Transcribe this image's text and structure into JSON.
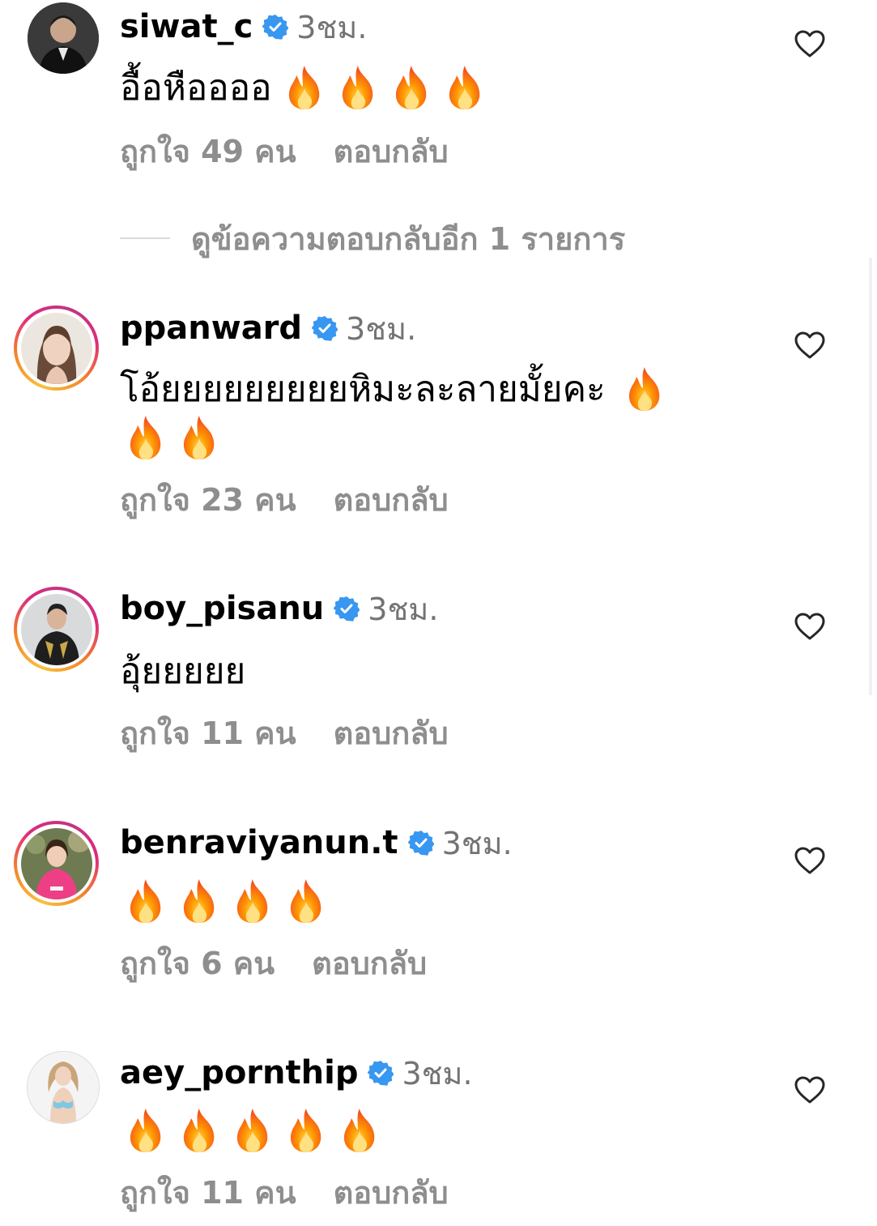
{
  "colors": {
    "text_primary": "#000000",
    "text_secondary": "#8e8e8e",
    "verified_blue": "#3897f0",
    "fire": "#f4511e"
  },
  "icons": {
    "verified": "verified-badge-icon",
    "like": "heart-outline-icon",
    "emoji": "fire-emoji"
  },
  "comments": [
    {
      "username": "siwat_c",
      "time": "3ชม.",
      "text": "อื้อหืออออ",
      "fire_count": 4,
      "likes": "ถูกใจ 49 คน",
      "reply_label": "ตอบกลับ",
      "story_ring": false
    },
    {
      "username": "ppanward",
      "time": "3ชม.",
      "text": "โอ้ยยยยยยยยยหิมะละลายมั้ยคะ",
      "fire_count": 3,
      "likes": "ถูกใจ 23 คน",
      "reply_label": "ตอบกลับ",
      "story_ring": true
    },
    {
      "username": "boy_pisanu",
      "time": "3ชม.",
      "text": "อุ้ยยยยย",
      "fire_count": 0,
      "likes": "ถูกใจ 11 คน",
      "reply_label": "ตอบกลับ",
      "story_ring": true
    },
    {
      "username": "benraviyanun.t",
      "time": "3ชม.",
      "text": "",
      "fire_count": 4,
      "likes": "ถูกใจ 6 คน",
      "reply_label": "ตอบกลับ",
      "story_ring": true
    },
    {
      "username": "aey_pornthip",
      "time": "3ชม.",
      "text": "",
      "fire_count": 5,
      "likes": "ถูกใจ 11 คน",
      "reply_label": "ตอบกลับ",
      "story_ring": false
    }
  ],
  "view_replies": {
    "label": "ดูข้อความตอบกลับอีก 1 รายการ"
  }
}
